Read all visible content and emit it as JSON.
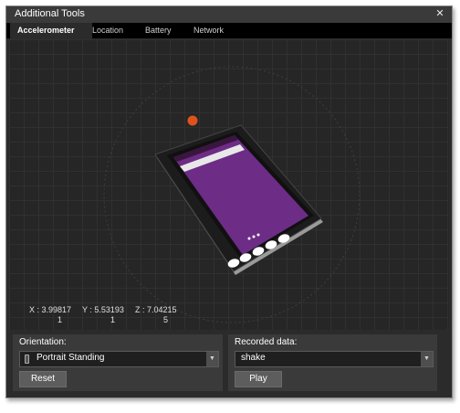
{
  "window": {
    "title": "Additional Tools",
    "close_glyph": "✕"
  },
  "tabs": [
    {
      "label": "Accelerometer",
      "active": true
    },
    {
      "label": "Location",
      "active": false
    },
    {
      "label": "Battery",
      "active": false
    },
    {
      "label": "Network",
      "active": false
    }
  ],
  "sensor": {
    "x": {
      "line1": "X : 3.99817",
      "line2": "1"
    },
    "y": {
      "line1": "Y : 5.53193",
      "line2": "1"
    },
    "z": {
      "line1": "Z : 7.04215",
      "line2": "5"
    }
  },
  "orientation": {
    "label": "Orientation:",
    "value": "Portrait Standing",
    "reset_label": "Reset"
  },
  "recorded": {
    "label": "Recorded data:",
    "value": "shake",
    "play_label": "Play"
  },
  "colors": {
    "accent_dot": "#e0521c",
    "screen_purple": "#6d2c86"
  },
  "icons": {
    "dropdown": "▼",
    "orientation": "phone-icon"
  }
}
